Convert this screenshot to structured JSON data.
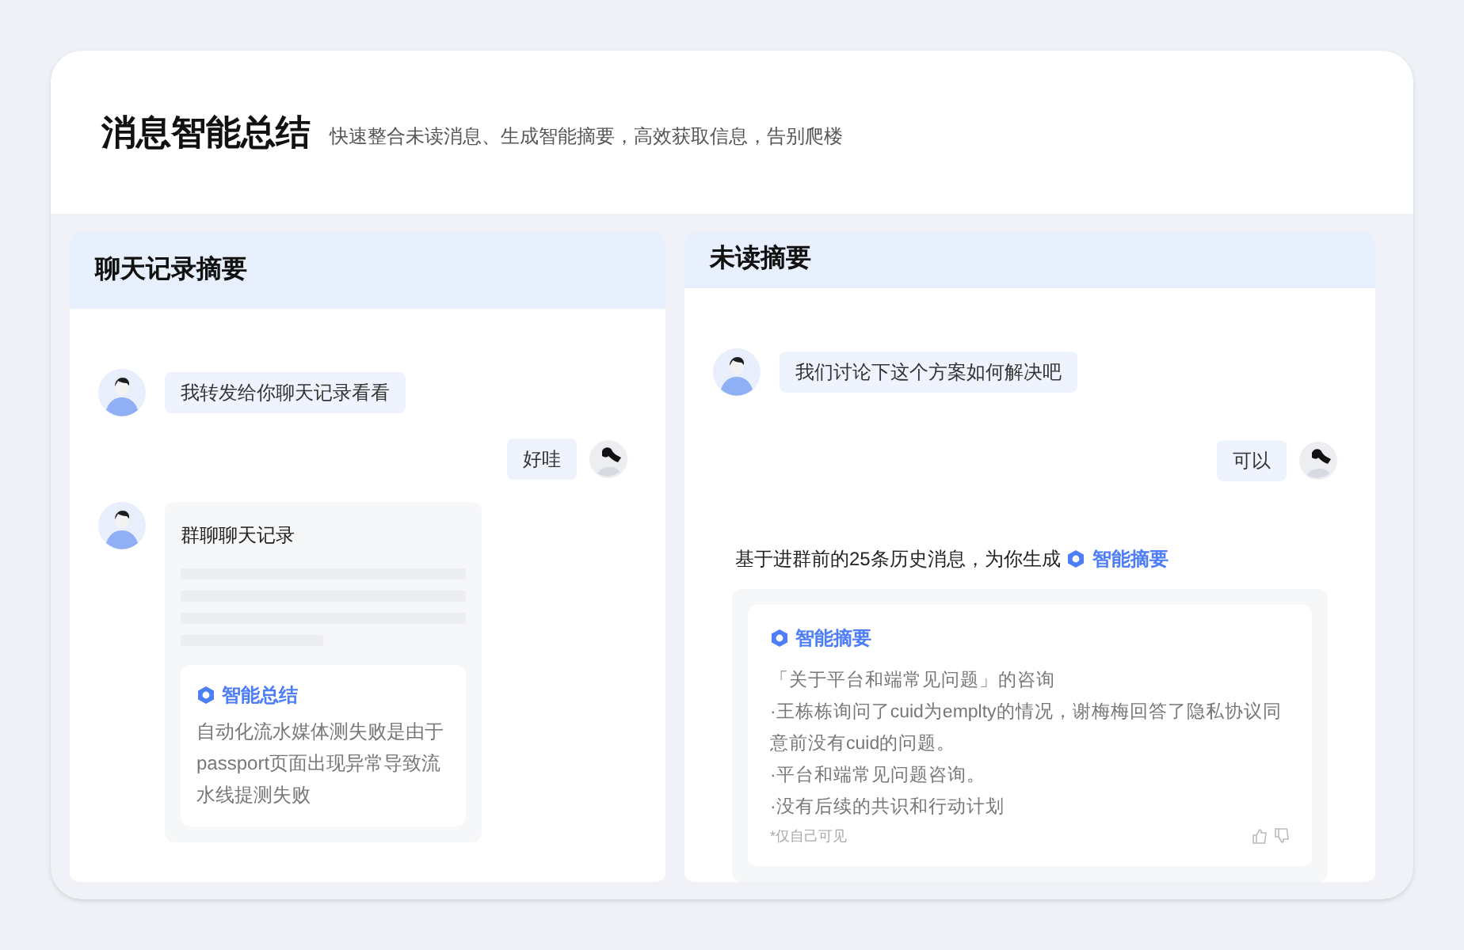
{
  "header": {
    "title": "消息智能总结",
    "subtitle": "快速整合未读消息、生成智能摘要，高效获取信息，告别爬楼"
  },
  "panels": [
    {
      "title": "聊天记录摘要",
      "messages": [
        {
          "kind": "incoming",
          "text": "我转发给你聊天记录看看"
        },
        {
          "kind": "outgoing",
          "text": "好哇"
        },
        {
          "kind": "record",
          "title": "群聊聊天记录",
          "summary_label": "智能总结",
          "summary": "自动化流水媒体测失败是由于passport页面出现异常导致流水线提测失败"
        }
      ]
    },
    {
      "title": "未读摘要",
      "messages": [
        {
          "kind": "incoming",
          "text": "我们讨论下这个方案如何解决吧"
        },
        {
          "kind": "outgoing",
          "text": "可以"
        },
        {
          "kind": "digest",
          "intro": "基于进群前的25条历史消息，为你生成",
          "intro_link": "智能摘要",
          "label": "智能摘要",
          "lines": [
            "「关于平台和端常见问题」的咨询",
            "·王栋栋询问了cuid为emplty的情况，谢梅梅回答了隐私协议同意前没有cuid的问题。",
            "·平台和端常见问题咨询。",
            "·没有后续的共识和行动计划"
          ],
          "note": "*仅自己可见"
        }
      ]
    }
  ]
}
